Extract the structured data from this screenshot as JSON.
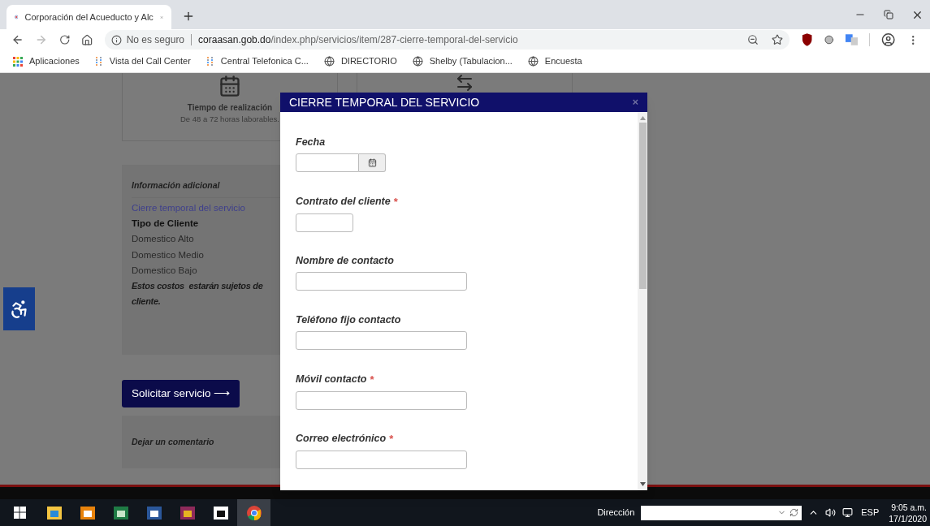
{
  "browser": {
    "tab_title": "Corporación del Acueducto y Alc",
    "security": "No es seguro",
    "url_domain": "coraasan.gob.do",
    "url_path": "/index.php/servicios/item/287-cierre-temporal-del-servicio",
    "bookmarks": [
      {
        "label": "Aplicaciones",
        "kind": "apps"
      },
      {
        "label": "Vista del Call Center",
        "kind": "dots"
      },
      {
        "label": "Central Telefonica C...",
        "kind": "dots"
      },
      {
        "label": "DIRECTORIO",
        "kind": "globe"
      },
      {
        "label": "Shelby (Tabulacion...",
        "kind": "globe"
      },
      {
        "label": "Encuesta",
        "kind": "globe"
      }
    ]
  },
  "page": {
    "card": {
      "title": "Tiempo de realización",
      "text": "De 48 a 72 horas laborables."
    },
    "info": {
      "heading": "Información adicional",
      "link": "Cierre temporal del servicio",
      "subheading": "Tipo de Cliente",
      "items": [
        "Domestico Alto",
        "Domestico Medio",
        "Domestico Bajo"
      ],
      "note_lines": [
        "Estos costos  estarán sujetos de",
        "cliente."
      ]
    },
    "request_button": "Solicitar servicio ⟶",
    "comment_heading": "Dejar un comentario"
  },
  "modal": {
    "title": "CIERRE TEMPORAL DEL SERVICIO",
    "close": "×",
    "fields": [
      {
        "label": "Fecha",
        "kind": "date",
        "required": false
      },
      {
        "label": "Contrato del cliente",
        "kind": "short",
        "required": true
      },
      {
        "label": "Nombre de contacto",
        "kind": "text",
        "required": false
      },
      {
        "label": "Teléfono fijo contacto",
        "kind": "text",
        "required": false
      },
      {
        "label": "Móvil contacto",
        "kind": "text",
        "required": true
      },
      {
        "label": "Correo electrónico ",
        "kind": "text",
        "required": true
      }
    ],
    "required_mark": "*"
  },
  "taskbar": {
    "address_label": "Dirección",
    "language": "ESP",
    "time": "9:05 a.m.",
    "date": "17/1/2020"
  }
}
